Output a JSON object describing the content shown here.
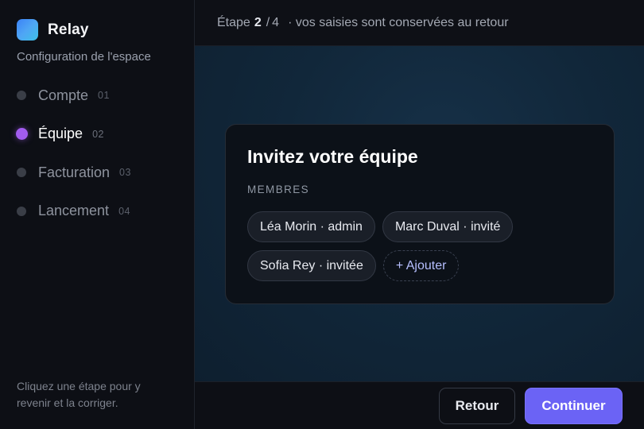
{
  "brand": {
    "name": "Relay",
    "subtitle": "Configuration de l'espace"
  },
  "steps": [
    {
      "label": "Compte",
      "number": "01",
      "active": false
    },
    {
      "label": "Équipe",
      "number": "02",
      "active": true
    },
    {
      "label": "Facturation",
      "number": "03",
      "active": false
    },
    {
      "label": "Lancement",
      "number": "04",
      "active": false
    }
  ],
  "sidebar_hint": "Cliquez une étape pour y revenir et la corriger.",
  "topbar": {
    "prefix": "Étape",
    "current": "2",
    "separator": "/",
    "total": "4",
    "hint": "· vos saisies sont conservées au retour"
  },
  "card": {
    "title": "Invitez votre équipe",
    "section_label": "MEMBRES",
    "members": [
      {
        "label": "Léa Morin · admin"
      },
      {
        "label": "Marc Duval · invité"
      },
      {
        "label": "Sofia Rey · invitée"
      }
    ],
    "add_label": "+ Ajouter"
  },
  "footer": {
    "back_label": "Retour",
    "continue_label": "Continuer"
  },
  "colors": {
    "accent": "#6b63f5",
    "active_step": "#a25cf0",
    "logo_gradient_start": "#3b82f6",
    "logo_gradient_end": "#3ec0e6"
  }
}
